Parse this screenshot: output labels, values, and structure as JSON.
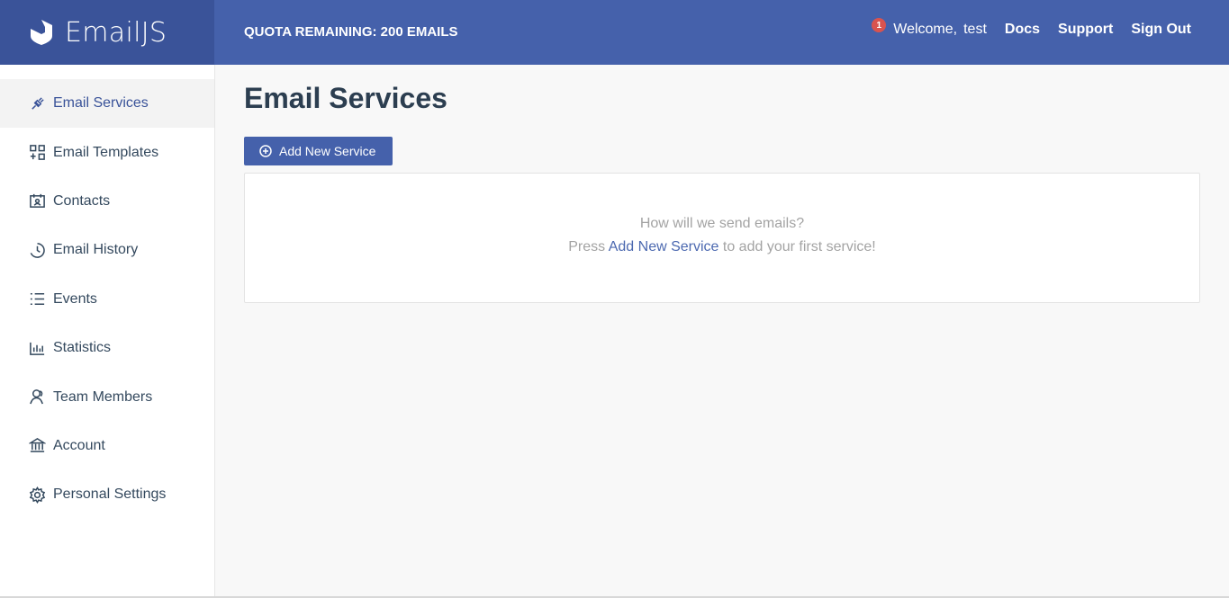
{
  "brand": {
    "name": "EmailJS"
  },
  "header": {
    "quota": "QUOTA REMAINING: 200 EMAILS",
    "notification_count": "1",
    "welcome": "Welcome,",
    "username": "test",
    "links": {
      "docs": "Docs",
      "support": "Support",
      "sign_out": "Sign Out"
    }
  },
  "sidebar": {
    "items": [
      {
        "label": "Email Services",
        "icon": "plug-icon"
      },
      {
        "label": "Email Templates",
        "icon": "template-icon"
      },
      {
        "label": "Contacts",
        "icon": "contacts-icon"
      },
      {
        "label": "Email History",
        "icon": "history-icon"
      },
      {
        "label": "Events",
        "icon": "list-icon"
      },
      {
        "label": "Statistics",
        "icon": "chart-icon"
      },
      {
        "label": "Team Members",
        "icon": "team-icon"
      },
      {
        "label": "Account",
        "icon": "bank-icon"
      },
      {
        "label": "Personal Settings",
        "icon": "gear-icon"
      }
    ]
  },
  "main": {
    "title": "Email Services",
    "add_button": "Add New Service",
    "empty": {
      "line1": "How will we send emails?",
      "line2_prefix": "Press",
      "line2_link": "Add New Service",
      "line2_suffix": "to add your first service!"
    }
  },
  "colors": {
    "primary": "#4561ab",
    "brand_bg": "#3a5399",
    "badge": "#d9534f"
  }
}
